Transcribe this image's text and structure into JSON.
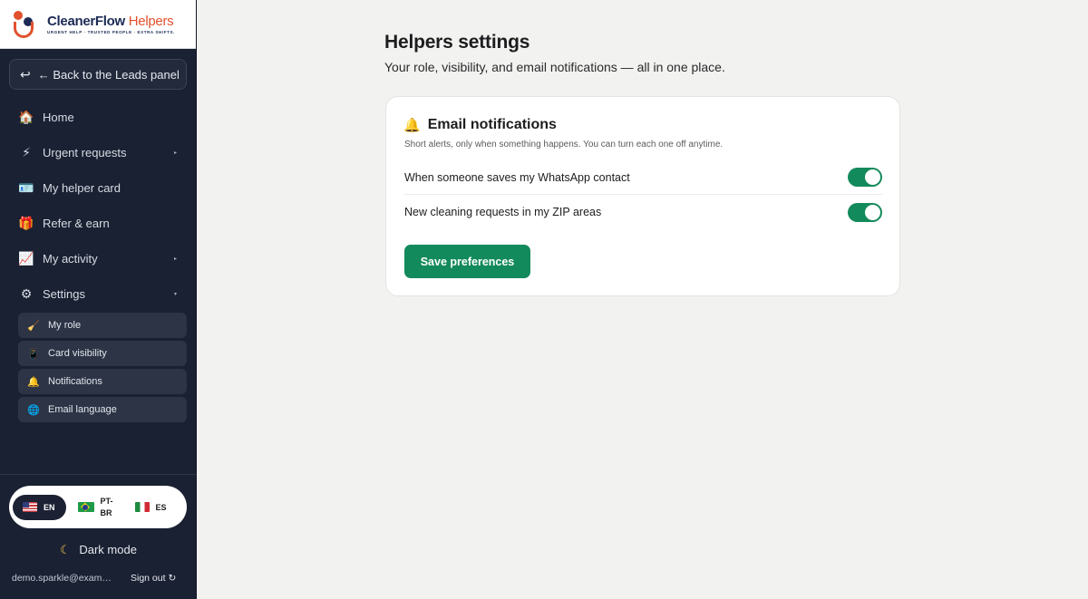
{
  "brand": {
    "name_part1": "CleanerFlow",
    "name_part2": "Helpers",
    "tagline": "URGENT HELP · TRUSTED PEOPLE · EXTRA SHIFTS.",
    "colors": {
      "orange": "#e2512d",
      "navy": "#1c2a55"
    }
  },
  "sidebar": {
    "back_label": "← Back to the Leads panel",
    "back_icon": "return-arrow-icon",
    "items": [
      {
        "label": "Home",
        "icon": "🏠",
        "icon_name": "house-icon",
        "has_caret": false
      },
      {
        "label": "Urgent requests",
        "icon": "⚡",
        "icon_name": "lightning-icon",
        "has_caret": true
      },
      {
        "label": "My helper card",
        "icon": "🪪",
        "icon_name": "id-card-icon",
        "has_caret": false
      },
      {
        "label": "Refer & earn",
        "icon": "🎁",
        "icon_name": "gift-icon",
        "has_caret": false
      },
      {
        "label": "My activity",
        "icon": "📈",
        "icon_name": "chart-icon",
        "has_caret": true
      },
      {
        "label": "Settings",
        "icon": "⚙",
        "icon_name": "gear-icon",
        "has_caret": true
      }
    ],
    "subitems": [
      {
        "label": "My role",
        "icon": "🧹",
        "icon_name": "role-icon"
      },
      {
        "label": "Card visibility",
        "icon": "📱",
        "icon_name": "phone-icon"
      },
      {
        "label": "Notifications",
        "icon": "🔔",
        "icon_name": "bell-icon"
      },
      {
        "label": "Email language",
        "icon": "🌐",
        "icon_name": "globe-icon"
      }
    ],
    "languages": [
      {
        "code": "EN",
        "flag": "us",
        "active": true
      },
      {
        "code": "PT-BR",
        "flag": "br",
        "active": false
      },
      {
        "code": "ES",
        "flag": "it",
        "active": false
      }
    ],
    "dark_mode_label": "Dark mode",
    "email": "demo.sparkle@exampl...",
    "sign_out_label": "Sign out"
  },
  "main": {
    "title": "Helpers settings",
    "subtitle": "Your role, visibility, and email notifications — all in one place."
  },
  "notifications_card": {
    "title": "Email notifications",
    "title_icon": "🔔",
    "description": "Short alerts, only when something happens. You can turn each one off anytime.",
    "options": [
      {
        "label": "When someone saves my WhatsApp contact",
        "enabled": true
      },
      {
        "label": "New cleaning requests in my ZIP areas",
        "enabled": true
      }
    ],
    "save_label": "Save preferences",
    "accent": "#138a5b"
  }
}
